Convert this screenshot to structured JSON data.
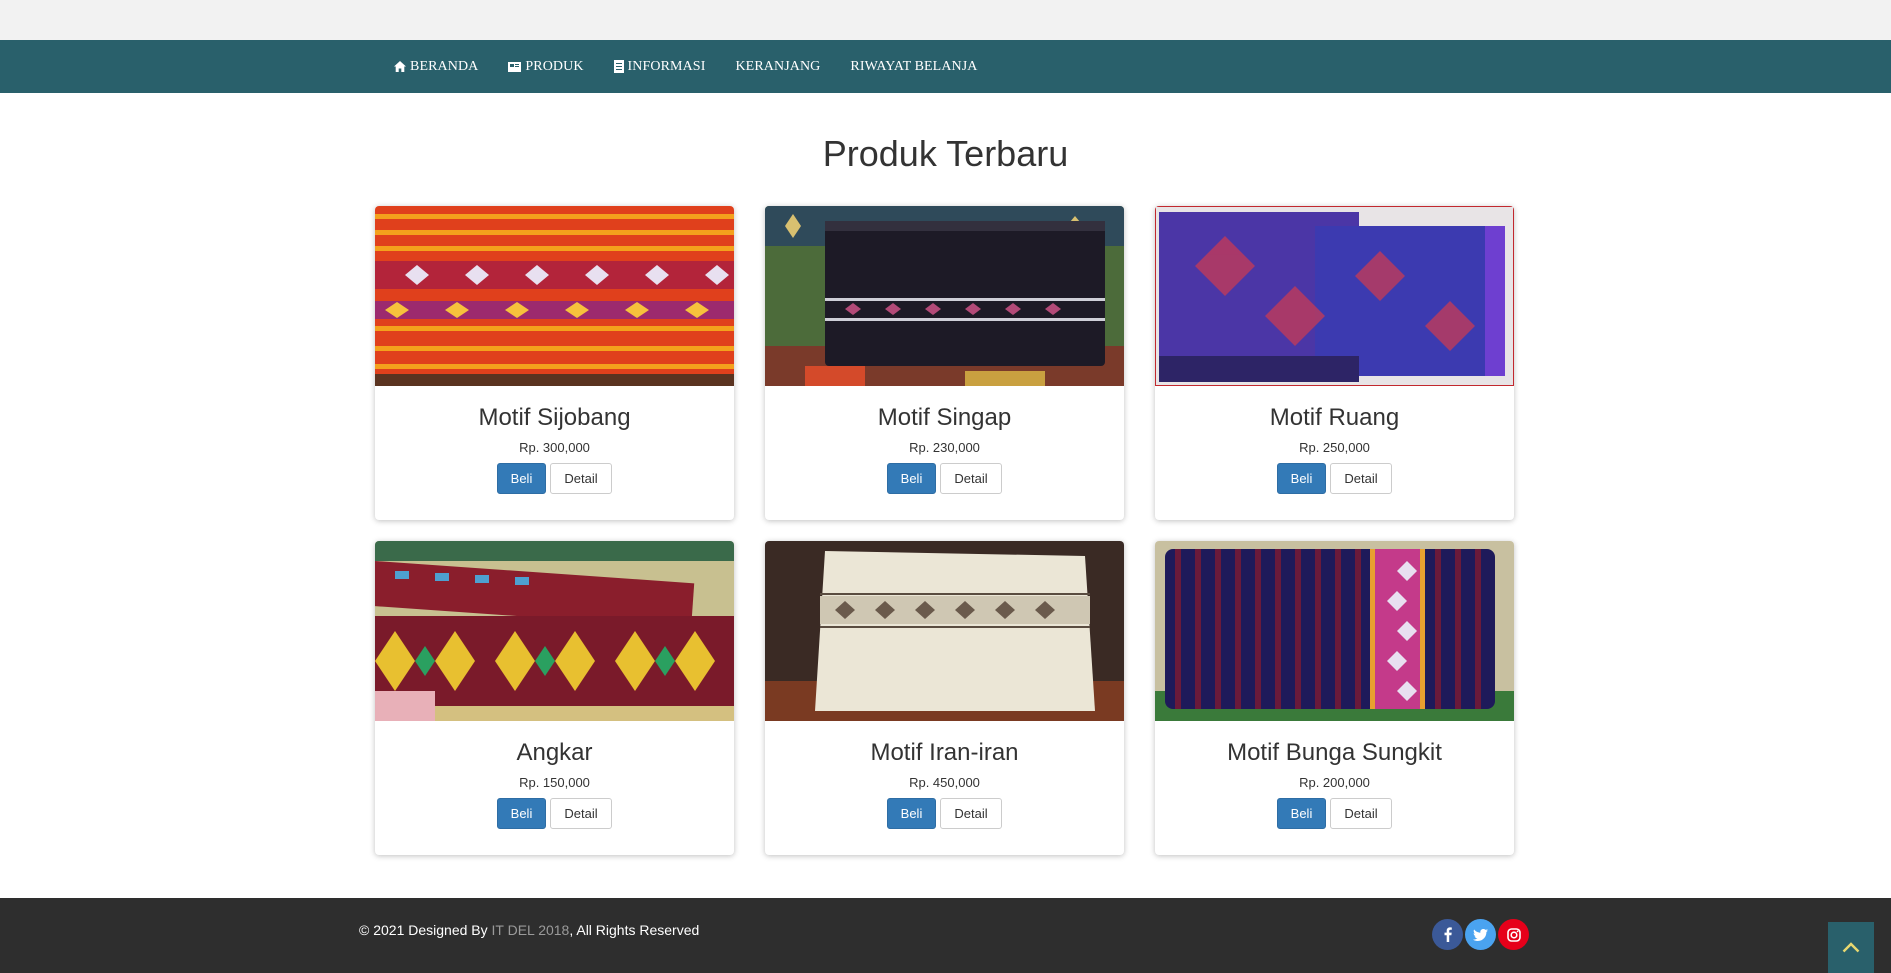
{
  "nav": {
    "items": [
      {
        "label": "BERANDA",
        "icon": "home-icon"
      },
      {
        "label": "PRODUK",
        "icon": "product-icon"
      },
      {
        "label": "INFORMASI",
        "icon": "document-icon"
      },
      {
        "label": "KERANJANG",
        "icon": ""
      },
      {
        "label": "RIWAYAT BELANJA",
        "icon": ""
      }
    ]
  },
  "section": {
    "title": "Produk Terbaru"
  },
  "products": [
    {
      "name": "Motif Sijobang",
      "price": "Rp. 300,000",
      "beli": "Beli",
      "detail": "Detail"
    },
    {
      "name": "Motif Singap",
      "price": "Rp. 230,000",
      "beli": "Beli",
      "detail": "Detail"
    },
    {
      "name": "Motif Ruang",
      "price": "Rp. 250,000",
      "beli": "Beli",
      "detail": "Detail"
    },
    {
      "name": "Angkar",
      "price": "Rp. 150,000",
      "beli": "Beli",
      "detail": "Detail"
    },
    {
      "name": "Motif Iran-iran",
      "price": "Rp. 450,000",
      "beli": "Beli",
      "detail": "Detail"
    },
    {
      "name": "Motif Bunga Sungkit",
      "price": "Rp. 200,000",
      "beli": "Beli",
      "detail": "Detail"
    }
  ],
  "footer": {
    "prefix": "© 2021 Designed By ",
    "brand": "IT DEL 2018",
    "suffix": ", All Rights Reserved",
    "social": [
      {
        "name": "facebook-icon",
        "color": "#3b5998"
      },
      {
        "name": "twitter-icon",
        "color": "#4aa3f0"
      },
      {
        "name": "instagram-icon",
        "color": "#e6001a"
      }
    ]
  },
  "colors": {
    "navbar": "#29606b",
    "primary_button": "#337ab7",
    "footer": "#2e2e2e"
  }
}
